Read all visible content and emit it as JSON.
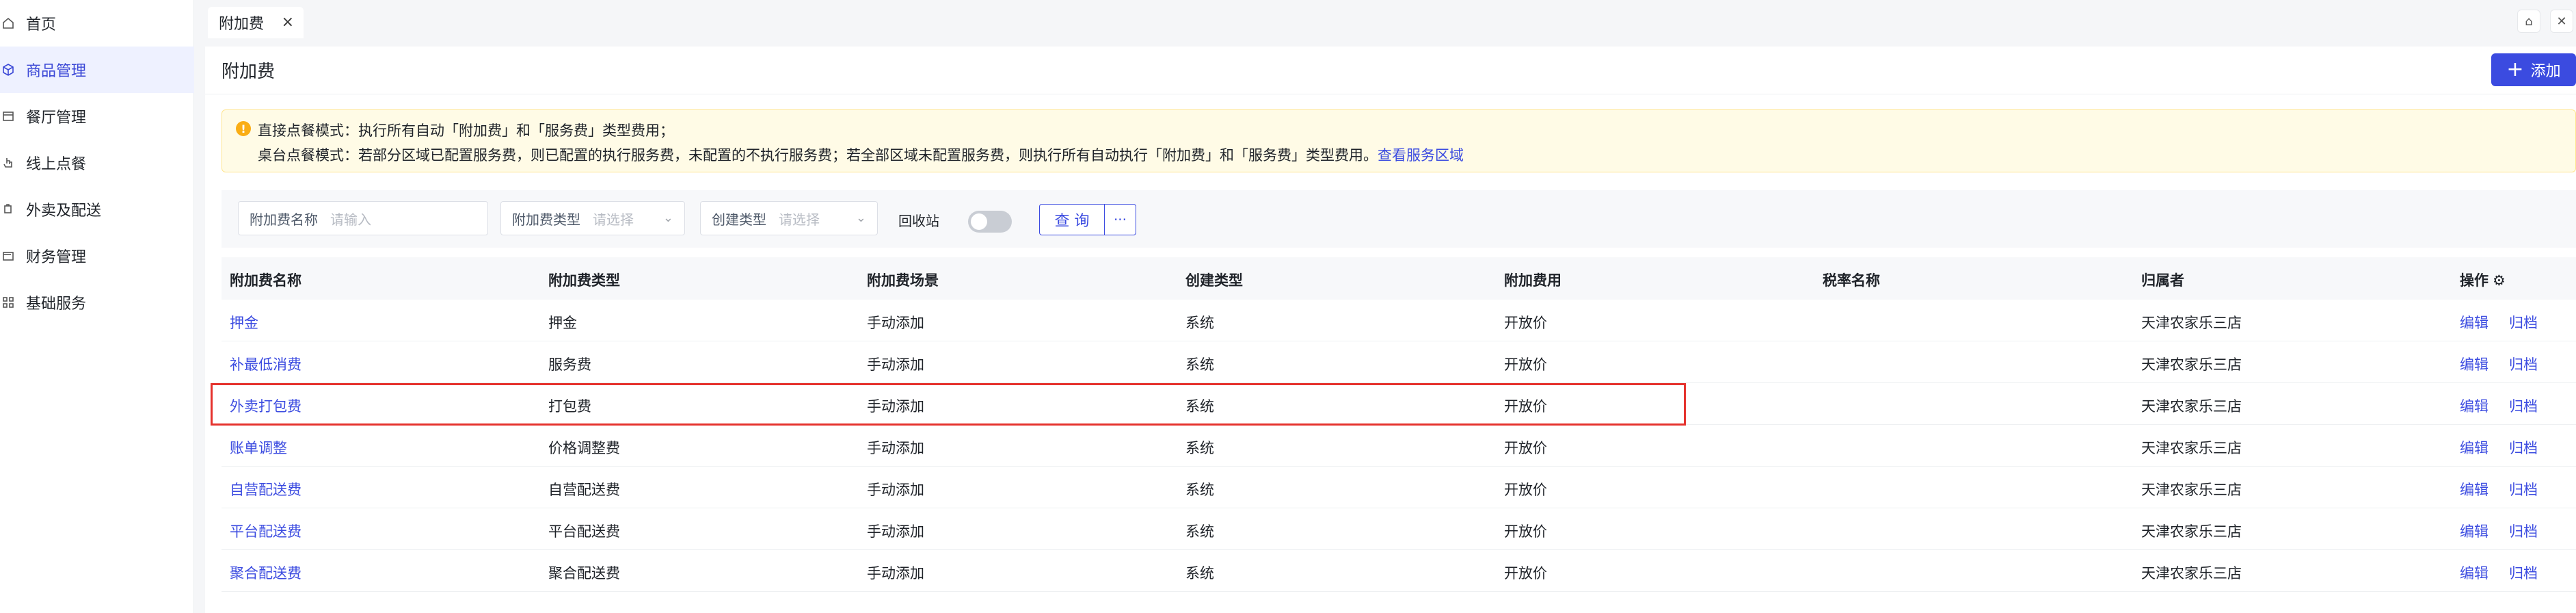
{
  "sidebar": {
    "items": [
      {
        "label": "首页",
        "icon": "home-icon"
      },
      {
        "label": "商品管理",
        "icon": "cube-icon",
        "active": true
      },
      {
        "label": "餐厅管理",
        "icon": "store-icon"
      },
      {
        "label": "线上点餐",
        "icon": "tap-icon"
      },
      {
        "label": "外卖及配送",
        "icon": "delivery-icon"
      },
      {
        "label": "财务管理",
        "icon": "wallet-icon"
      },
      {
        "label": "基础服务",
        "icon": "grid-icon"
      }
    ]
  },
  "tabs": {
    "active": {
      "label": "附加费",
      "close": "×"
    }
  },
  "topbar": {
    "icon1": "⌂",
    "icon2": "✕"
  },
  "page": {
    "title": "附加费",
    "add_label": "添加"
  },
  "notice": {
    "line1": "直接点餐模式：执行所有自动「附加费」和「服务费」类型费用；",
    "line2": "桌台点餐模式：若部分区域已配置服务费，则已配置的执行服务费，未配置的不执行服务费；若全部区域未配置服务费，则执行所有自动执行「附加费」和「服务费」类型费用。",
    "link": "查看服务区域"
  },
  "filters": {
    "name_label": "附加费名称",
    "name_placeholder": "请输入",
    "type_label": "附加费类型",
    "type_placeholder": "请选择",
    "create_label": "创建类型",
    "create_placeholder": "请选择",
    "recycle_label": "回收站",
    "query_label": "查 询",
    "more_label": "···"
  },
  "table": {
    "columns": [
      "附加费名称",
      "附加费类型",
      "附加费场景",
      "创建类型",
      "附加费用",
      "税率名称",
      "归属者",
      "操作"
    ],
    "actions": {
      "edit": "编辑",
      "archive": "归档"
    },
    "rows": [
      {
        "name": "押金",
        "type": "押金",
        "scene": "手动添加",
        "create": "系统",
        "fee": "开放价",
        "tax": "",
        "owner": "天津农家乐三店"
      },
      {
        "name": "补最低消费",
        "type": "服务费",
        "scene": "手动添加",
        "create": "系统",
        "fee": "开放价",
        "tax": "",
        "owner": "天津农家乐三店"
      },
      {
        "name": "外卖打包费",
        "type": "打包费",
        "scene": "手动添加",
        "create": "系统",
        "fee": "开放价",
        "tax": "",
        "owner": "天津农家乐三店"
      },
      {
        "name": "账单调整",
        "type": "价格调整费",
        "scene": "手动添加",
        "create": "系统",
        "fee": "开放价",
        "tax": "",
        "owner": "天津农家乐三店"
      },
      {
        "name": "自营配送费",
        "type": "自营配送费",
        "scene": "手动添加",
        "create": "系统",
        "fee": "开放价",
        "tax": "",
        "owner": "天津农家乐三店"
      },
      {
        "name": "平台配送费",
        "type": "平台配送费",
        "scene": "手动添加",
        "create": "系统",
        "fee": "开放价",
        "tax": "",
        "owner": "天津农家乐三店"
      },
      {
        "name": "聚合配送费",
        "type": "聚合配送费",
        "scene": "手动添加",
        "create": "系统",
        "fee": "开放价",
        "tax": "",
        "owner": "天津农家乐三店"
      }
    ]
  },
  "colors": {
    "accent": "#3b4be0",
    "highlight": "#e5322d",
    "notice_bg": "#fffbe6"
  }
}
